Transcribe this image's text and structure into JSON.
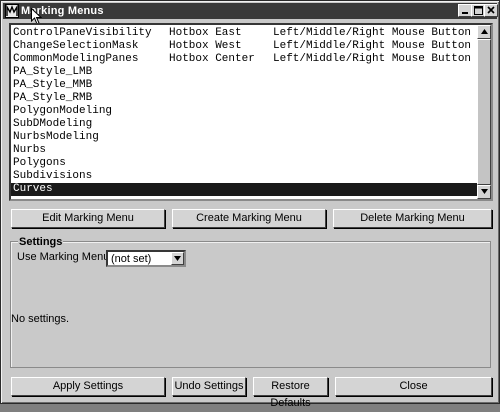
{
  "window": {
    "title": "Marking Menus"
  },
  "list": {
    "rows": [
      {
        "name": "ControlPaneVisibility",
        "hotbox": "Hotbox East",
        "mouse": "Left/Middle/Right Mouse Button"
      },
      {
        "name": "ChangeSelectionMask",
        "hotbox": "Hotbox West",
        "mouse": "Left/Middle/Right Mouse Button"
      },
      {
        "name": "CommonModelingPanes",
        "hotbox": "Hotbox Center",
        "mouse": "Left/Middle/Right Mouse Button"
      },
      {
        "name": "PA_Style_LMB",
        "hotbox": "",
        "mouse": ""
      },
      {
        "name": "PA_Style_MMB",
        "hotbox": "",
        "mouse": ""
      },
      {
        "name": "PA_Style_RMB",
        "hotbox": "",
        "mouse": ""
      },
      {
        "name": "PolygonModeling",
        "hotbox": "",
        "mouse": ""
      },
      {
        "name": "SubDModeling",
        "hotbox": "",
        "mouse": ""
      },
      {
        "name": "NurbsModeling",
        "hotbox": "",
        "mouse": ""
      },
      {
        "name": "Nurbs",
        "hotbox": "",
        "mouse": ""
      },
      {
        "name": "Polygons",
        "hotbox": "",
        "mouse": ""
      },
      {
        "name": "Subdivisions",
        "hotbox": "",
        "mouse": ""
      },
      {
        "name": "Curves",
        "hotbox": "",
        "mouse": ""
      }
    ],
    "selected_index": 12
  },
  "actions": {
    "edit": "Edit Marking Menu",
    "create": "Create Marking Menu",
    "delete": "Delete Marking Menu"
  },
  "settings": {
    "title": "Settings",
    "use_label": "Use Marking Menu in:",
    "use_value": "(not set)",
    "empty_text": "No settings."
  },
  "footer": {
    "apply": "Apply Settings",
    "undo": "Undo Settings",
    "restore": "Restore Defaults",
    "close": "Close"
  },
  "icons": {
    "app": "maya-icon",
    "minimize": "minimize-icon",
    "maximize": "maximize-icon",
    "close": "close-icon",
    "scroll_up": "arrow-up-icon",
    "scroll_down": "arrow-down-icon",
    "combo": "chevron-down-icon"
  },
  "colors": {
    "titlebar": "#3a3a3a",
    "window": "#c9c9c9",
    "selection": "#1a1a1a"
  }
}
